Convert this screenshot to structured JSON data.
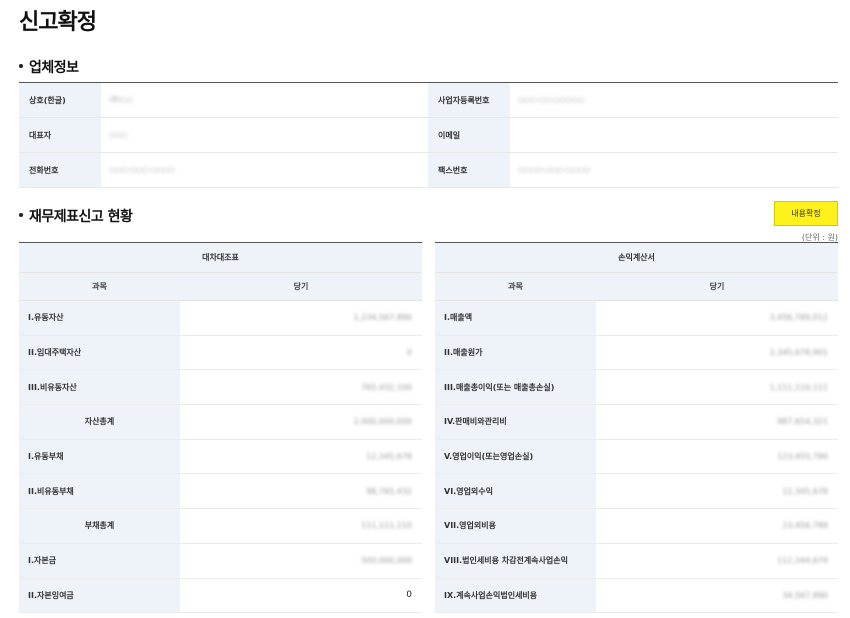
{
  "page": {
    "title": "신고확정"
  },
  "company_section": {
    "title": "업체정보",
    "rows": [
      {
        "left_label": "상호(한글)",
        "left_value": "(주)○○",
        "right_label": "사업자등록번호",
        "right_value": "○○○-○○-○○○○○"
      },
      {
        "left_label": "대표자",
        "left_value": "○○○",
        "right_label": "이메일",
        "right_value": ""
      },
      {
        "left_label": "전화번호",
        "left_value": "○○○-○○○-○○○○",
        "right_label": "팩스번호",
        "right_value": "○○○○-○○○-○○○○"
      }
    ]
  },
  "financial_section": {
    "title": "재무제표신고 현황",
    "confirm_button": "내용확정",
    "unit": "(단위 : 원)",
    "balance_sheet": {
      "caption": "대차대조표",
      "col_subject": "과목",
      "col_current": "당기",
      "rows": [
        {
          "subject": "I.유동자산",
          "value": "1,234,567,890"
        },
        {
          "subject": "II.임대주택자산",
          "value": "0"
        },
        {
          "subject": "III.비유동자산",
          "value": "765,432,100"
        },
        {
          "subject": "자산총계",
          "value": "2,000,000,000"
        },
        {
          "subject": "I.유동부채",
          "value": "12,345,678"
        },
        {
          "subject": "II.비유동부채",
          "value": "98,765,432"
        },
        {
          "subject": "부채총계",
          "value": "111,111,110"
        },
        {
          "subject": "I.자본금",
          "value": "500,000,000"
        },
        {
          "subject": "II.자본잉여금",
          "value": "0"
        }
      ]
    },
    "income_statement": {
      "caption": "손익계산서",
      "col_subject": "과목",
      "col_current": "당기",
      "rows": [
        {
          "subject": "I.매출액",
          "value": "3,456,789,012"
        },
        {
          "subject": "II.매출원가",
          "value": "2,345,678,901"
        },
        {
          "subject": "III.매출총이익(또는 매출총손실)",
          "value": "1,111,110,111"
        },
        {
          "subject": "IV.판매비와관리비",
          "value": "987,654,321"
        },
        {
          "subject": "V.영업이익(또는영업손실)",
          "value": "123,455,790"
        },
        {
          "subject": "VI.영업외수익",
          "value": "12,345,678"
        },
        {
          "subject": "VII.영업외비용",
          "value": "23,456,789"
        },
        {
          "subject": "VIII.법인세비용 차감전계속사업손익",
          "value": "112,344,679"
        },
        {
          "subject": "IX.계속사업손익법인세비용",
          "value": "34,567,890"
        }
      ]
    }
  }
}
